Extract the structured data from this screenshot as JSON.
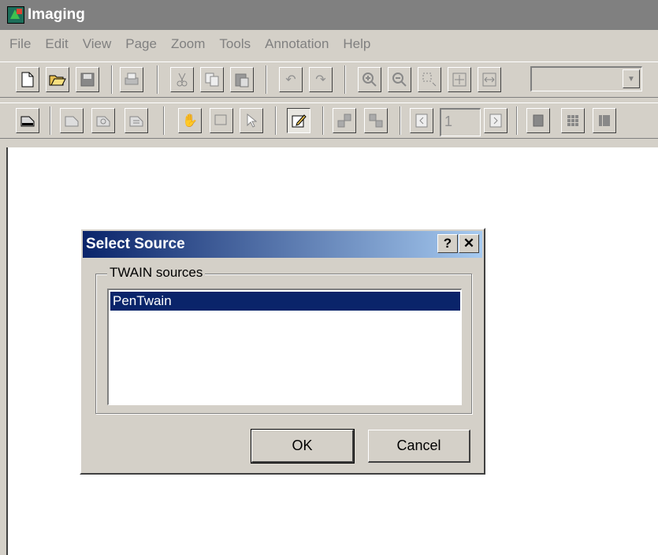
{
  "window": {
    "title": "Imaging"
  },
  "menu": {
    "items": [
      "File",
      "Edit",
      "View",
      "Page",
      "Zoom",
      "Tools",
      "Annotation",
      "Help"
    ]
  },
  "toolbar": {
    "zoom_value": "",
    "page_number": "1",
    "zoom_arrow": "▼"
  },
  "dialog": {
    "title": "Select Source",
    "help_button": "?",
    "close_button": "✕",
    "group_label": "TWAIN sources",
    "sources": [
      "PenTwain"
    ],
    "ok_label": "OK",
    "cancel_label": "Cancel"
  }
}
